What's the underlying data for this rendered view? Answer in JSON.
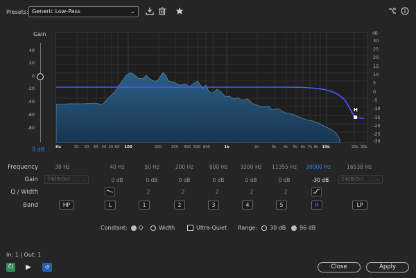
{
  "toolbar": {
    "presets_label": "Presets:",
    "preset_value": "Generic Low-Pass",
    "icons": [
      "save-preset-icon",
      "delete-icon",
      "star-icon",
      "route-icon",
      "info-icon"
    ]
  },
  "graph": {
    "gain_label": "Gain",
    "db_label": "dB",
    "left_ticks": [
      "40",
      "20",
      "0",
      "-20",
      "-40",
      "-60",
      "-80"
    ],
    "right_ticks": [
      "30",
      "25",
      "20",
      "15",
      "10",
      "5",
      "0",
      "-5",
      "-10",
      "-15",
      "-20",
      "-25",
      "-30"
    ],
    "x_ticks": [
      "Hz",
      "10",
      "20",
      "30",
      "40",
      "50",
      "60",
      "100",
      "200",
      "300",
      "400",
      "500",
      "600",
      "1k",
      "2k",
      "3k",
      "4k",
      "5k",
      "6k",
      "7k",
      "8k",
      "10k",
      "20k",
      "30k"
    ],
    "output_gain": "0 dB",
    "handle_label": "H"
  },
  "bands": {
    "frequency_label": "Frequency",
    "gain_label": "Gain",
    "qwidth_label": "Q / Width",
    "band_label": "Band",
    "frequencies": [
      "38 Hz",
      "40 Hz",
      "50 Hz",
      "200 Hz",
      "800 Hz",
      "3200 Hz",
      "11355 Hz",
      "20000 Hz",
      "16538 Hz"
    ],
    "gains": [
      "24dB/Oct",
      "0 dB",
      "0 dB",
      "0 dB",
      "0 dB",
      "0 dB",
      "0 dB",
      "-30 dB",
      "24dB/Oct"
    ],
    "q_values": [
      "",
      "",
      "2",
      "2",
      "2",
      "2",
      "2",
      "",
      ""
    ],
    "band_buttons": [
      "HP",
      "L",
      "1",
      "2",
      "3",
      "4",
      "5",
      "H",
      "LP"
    ]
  },
  "options": {
    "constant_label": "Constant:",
    "q_label": "Q",
    "width_label": "Width",
    "ultra_quiet_label": "Ultra-Quiet",
    "range_label": "Range:",
    "range_30": "30 dB",
    "range_96": "96 dB"
  },
  "footer": {
    "io_label": "In: 1 | Out: 1",
    "close_label": "Close",
    "apply_label": "Apply"
  },
  "colors": {
    "accent": "#2f8af0",
    "curve": "#4a5cff",
    "spectrum_fill": "#1f4a6b",
    "power_on": "#2e8b57"
  }
}
